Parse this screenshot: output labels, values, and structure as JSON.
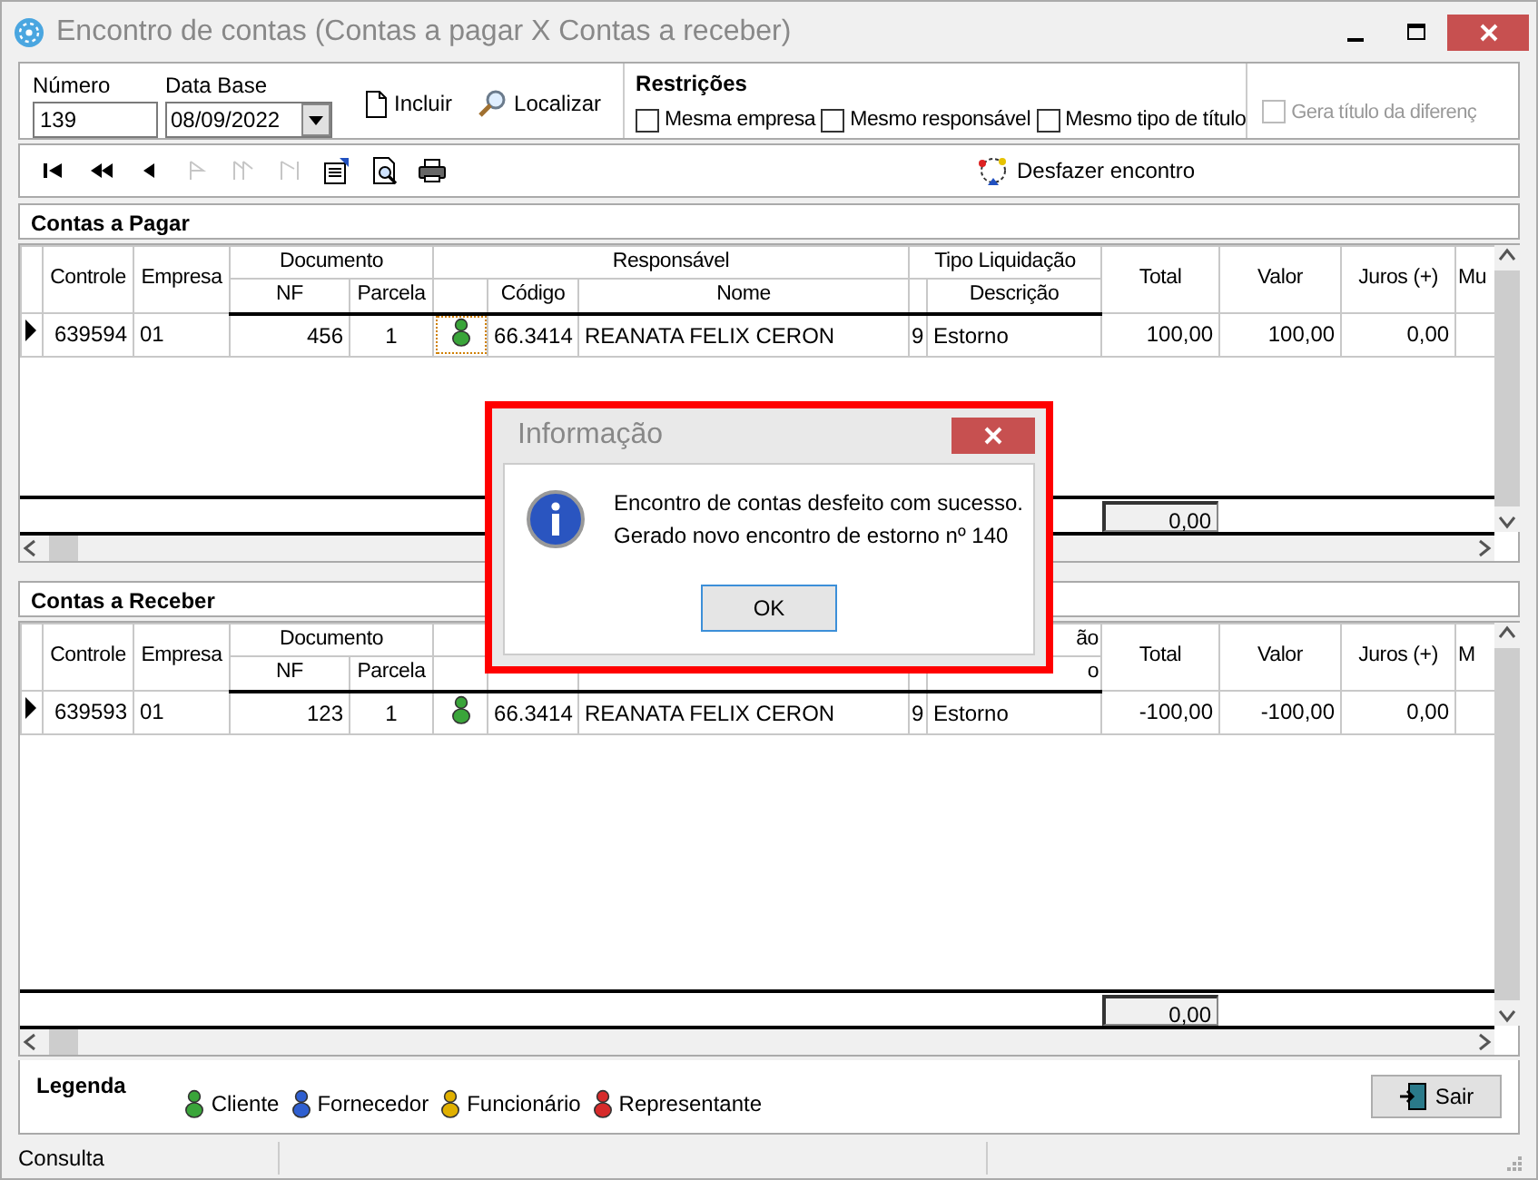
{
  "window": {
    "title": "Encontro de contas (Contas a pagar X Contas a receber)"
  },
  "header": {
    "numero": {
      "label": "Número",
      "value": "139"
    },
    "data_base": {
      "label": "Data Base",
      "value": "08/09/2022"
    },
    "buttons": [
      {
        "label": "Incluir",
        "kind": "new"
      },
      {
        "label": "Localizar",
        "kind": "find"
      }
    ],
    "restricoes": {
      "title": "Restrições",
      "options": [
        {
          "label": "Mesma empresa",
          "checked": false,
          "disabled": false
        },
        {
          "label": "Mesmo responsável",
          "checked": false,
          "disabled": false
        },
        {
          "label": "Mesmo tipo de título",
          "checked": false,
          "disabled": false
        },
        {
          "label": "Gera título da diferenç",
          "checked": false,
          "disabled": true
        }
      ]
    }
  },
  "toolbar": {
    "nav": [
      {
        "kind": "first",
        "disabled": false
      },
      {
        "kind": "prev_page",
        "disabled": false
      },
      {
        "kind": "prev",
        "disabled": false
      },
      {
        "kind": "next",
        "disabled": true
      },
      {
        "kind": "next_page",
        "disabled": true
      },
      {
        "kind": "last",
        "disabled": true
      },
      {
        "kind": "edit",
        "disabled": false
      },
      {
        "kind": "preview",
        "disabled": false
      },
      {
        "kind": "print",
        "disabled": false
      }
    ],
    "action": {
      "label": "Desfazer encontro"
    }
  },
  "grids": [
    {
      "title": "Contas a Pagar",
      "groups": {
        "documento": "Documento",
        "responsavel": "Responsável",
        "tipo_liquidacao": "Tipo Liquidação"
      },
      "columns": {
        "controle": "Controle",
        "empresa": "Empresa",
        "nf": "NF",
        "parcela": "Parcela",
        "codigo": "Código",
        "nome": "Nome",
        "descricao": "Descrição",
        "total": "Total",
        "valor": "Valor",
        "juros": "Juros (+)",
        "column_14": "Mu"
      },
      "rows": [
        {
          "current": true,
          "controle": "639594",
          "empresa": "01",
          "nf": "456",
          "parcela": "1",
          "color": "#3aa53a",
          "icon_focused": true,
          "codigo": "66.3414",
          "nome": "REANATA FELIX CERON",
          "tipo": "9",
          "descricao": "Estorno",
          "total": "100,00",
          "valor": "100,00",
          "juros": "0,00"
        }
      ],
      "sum": "0,00"
    },
    {
      "title": "Contas a Receber",
      "groups": {
        "documento": "Documento",
        "tipo_liquidacao": {
          "text": "ão",
          "cut": true
        }
      },
      "columns": {
        "controle": "Controle",
        "empresa": "Empresa",
        "nf": "NF",
        "parcela": "Parcela",
        "descricao": {
          "text": "o",
          "cut": true
        },
        "total": "Total",
        "valor": "Valor",
        "juros": "Juros (+)",
        "column_14": "M"
      },
      "rows": [
        {
          "current": true,
          "controle": "639593",
          "empresa": "01",
          "nf": "123",
          "parcela": "1",
          "color": "#3aa53a",
          "icon_focused": false,
          "codigo": "66.3414",
          "nome": "REANATA FELIX CERON",
          "tipo": "9",
          "descricao": "Estorno",
          "total": "-100,00",
          "valor": "-100,00",
          "juros": "0,00"
        }
      ],
      "sum": "0,00"
    }
  ],
  "legend": {
    "title": "Legenda",
    "items": [
      {
        "label": "Cliente",
        "color": "#3aa53a"
      },
      {
        "label": "Fornecedor",
        "color": "#2f5fd0"
      },
      {
        "label": "Funcionário",
        "color": "#e0b000"
      },
      {
        "label": "Representante",
        "color": "#d62a2a"
      }
    ]
  },
  "exit_button": {
    "label": "Sair"
  },
  "status_bar": {
    "text": "Consulta"
  },
  "dialog": {
    "title": "Informação",
    "lines": [
      "Encontro de contas desfeito com sucesso.",
      "Gerado novo encontro de estorno nº 140"
    ],
    "ok": {
      "label": "OK",
      "default": true
    }
  }
}
